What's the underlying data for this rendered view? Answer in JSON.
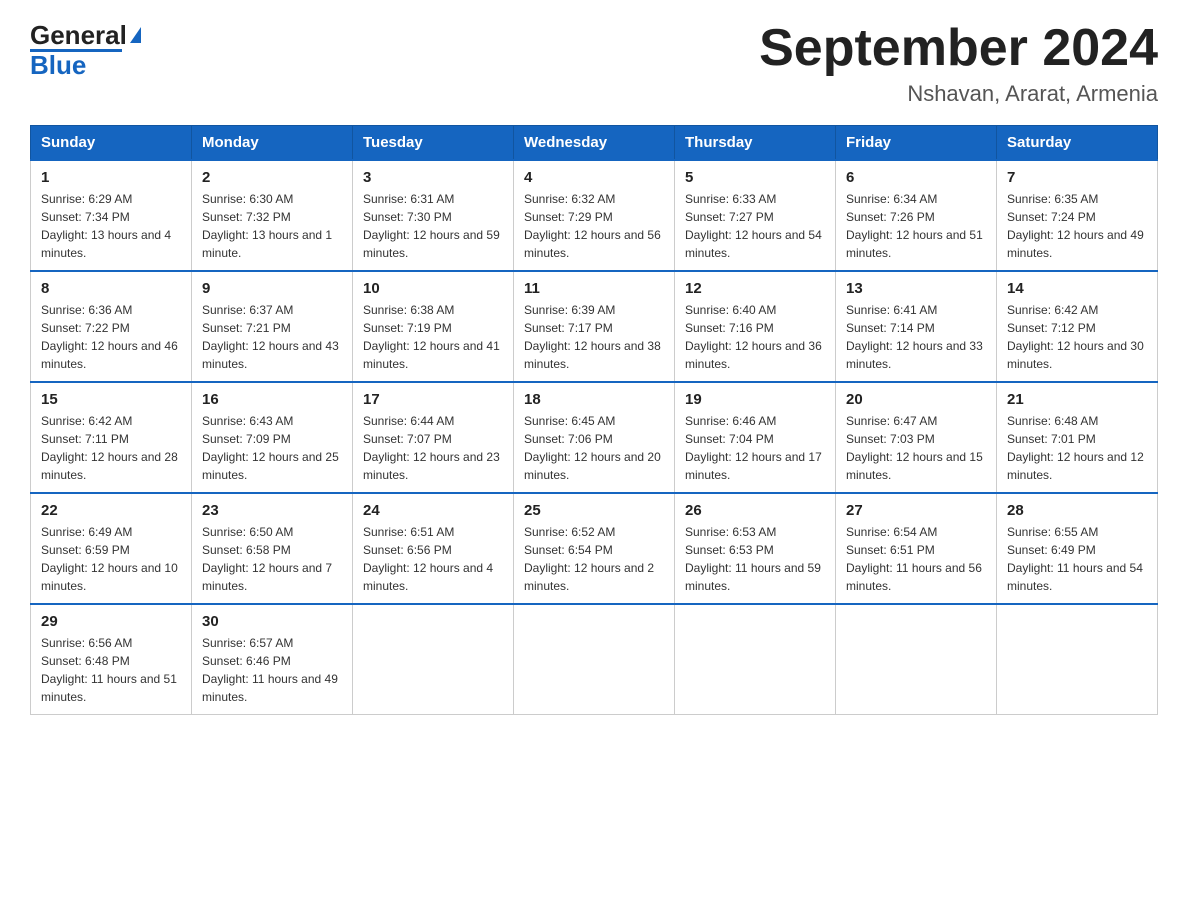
{
  "header": {
    "logo_general": "General",
    "logo_blue": "Blue",
    "month_title": "September 2024",
    "location": "Nshavan, Ararat, Armenia"
  },
  "calendar": {
    "days_of_week": [
      "Sunday",
      "Monday",
      "Tuesday",
      "Wednesday",
      "Thursday",
      "Friday",
      "Saturday"
    ],
    "weeks": [
      [
        {
          "day": "1",
          "sunrise": "6:29 AM",
          "sunset": "7:34 PM",
          "daylight": "13 hours and 4 minutes."
        },
        {
          "day": "2",
          "sunrise": "6:30 AM",
          "sunset": "7:32 PM",
          "daylight": "13 hours and 1 minute."
        },
        {
          "day": "3",
          "sunrise": "6:31 AM",
          "sunset": "7:30 PM",
          "daylight": "12 hours and 59 minutes."
        },
        {
          "day": "4",
          "sunrise": "6:32 AM",
          "sunset": "7:29 PM",
          "daylight": "12 hours and 56 minutes."
        },
        {
          "day": "5",
          "sunrise": "6:33 AM",
          "sunset": "7:27 PM",
          "daylight": "12 hours and 54 minutes."
        },
        {
          "day": "6",
          "sunrise": "6:34 AM",
          "sunset": "7:26 PM",
          "daylight": "12 hours and 51 minutes."
        },
        {
          "day": "7",
          "sunrise": "6:35 AM",
          "sunset": "7:24 PM",
          "daylight": "12 hours and 49 minutes."
        }
      ],
      [
        {
          "day": "8",
          "sunrise": "6:36 AM",
          "sunset": "7:22 PM",
          "daylight": "12 hours and 46 minutes."
        },
        {
          "day": "9",
          "sunrise": "6:37 AM",
          "sunset": "7:21 PM",
          "daylight": "12 hours and 43 minutes."
        },
        {
          "day": "10",
          "sunrise": "6:38 AM",
          "sunset": "7:19 PM",
          "daylight": "12 hours and 41 minutes."
        },
        {
          "day": "11",
          "sunrise": "6:39 AM",
          "sunset": "7:17 PM",
          "daylight": "12 hours and 38 minutes."
        },
        {
          "day": "12",
          "sunrise": "6:40 AM",
          "sunset": "7:16 PM",
          "daylight": "12 hours and 36 minutes."
        },
        {
          "day": "13",
          "sunrise": "6:41 AM",
          "sunset": "7:14 PM",
          "daylight": "12 hours and 33 minutes."
        },
        {
          "day": "14",
          "sunrise": "6:42 AM",
          "sunset": "7:12 PM",
          "daylight": "12 hours and 30 minutes."
        }
      ],
      [
        {
          "day": "15",
          "sunrise": "6:42 AM",
          "sunset": "7:11 PM",
          "daylight": "12 hours and 28 minutes."
        },
        {
          "day": "16",
          "sunrise": "6:43 AM",
          "sunset": "7:09 PM",
          "daylight": "12 hours and 25 minutes."
        },
        {
          "day": "17",
          "sunrise": "6:44 AM",
          "sunset": "7:07 PM",
          "daylight": "12 hours and 23 minutes."
        },
        {
          "day": "18",
          "sunrise": "6:45 AM",
          "sunset": "7:06 PM",
          "daylight": "12 hours and 20 minutes."
        },
        {
          "day": "19",
          "sunrise": "6:46 AM",
          "sunset": "7:04 PM",
          "daylight": "12 hours and 17 minutes."
        },
        {
          "day": "20",
          "sunrise": "6:47 AM",
          "sunset": "7:03 PM",
          "daylight": "12 hours and 15 minutes."
        },
        {
          "day": "21",
          "sunrise": "6:48 AM",
          "sunset": "7:01 PM",
          "daylight": "12 hours and 12 minutes."
        }
      ],
      [
        {
          "day": "22",
          "sunrise": "6:49 AM",
          "sunset": "6:59 PM",
          "daylight": "12 hours and 10 minutes."
        },
        {
          "day": "23",
          "sunrise": "6:50 AM",
          "sunset": "6:58 PM",
          "daylight": "12 hours and 7 minutes."
        },
        {
          "day": "24",
          "sunrise": "6:51 AM",
          "sunset": "6:56 PM",
          "daylight": "12 hours and 4 minutes."
        },
        {
          "day": "25",
          "sunrise": "6:52 AM",
          "sunset": "6:54 PM",
          "daylight": "12 hours and 2 minutes."
        },
        {
          "day": "26",
          "sunrise": "6:53 AM",
          "sunset": "6:53 PM",
          "daylight": "11 hours and 59 minutes."
        },
        {
          "day": "27",
          "sunrise": "6:54 AM",
          "sunset": "6:51 PM",
          "daylight": "11 hours and 56 minutes."
        },
        {
          "day": "28",
          "sunrise": "6:55 AM",
          "sunset": "6:49 PM",
          "daylight": "11 hours and 54 minutes."
        }
      ],
      [
        {
          "day": "29",
          "sunrise": "6:56 AM",
          "sunset": "6:48 PM",
          "daylight": "11 hours and 51 minutes."
        },
        {
          "day": "30",
          "sunrise": "6:57 AM",
          "sunset": "6:46 PM",
          "daylight": "11 hours and 49 minutes."
        },
        null,
        null,
        null,
        null,
        null
      ]
    ]
  }
}
